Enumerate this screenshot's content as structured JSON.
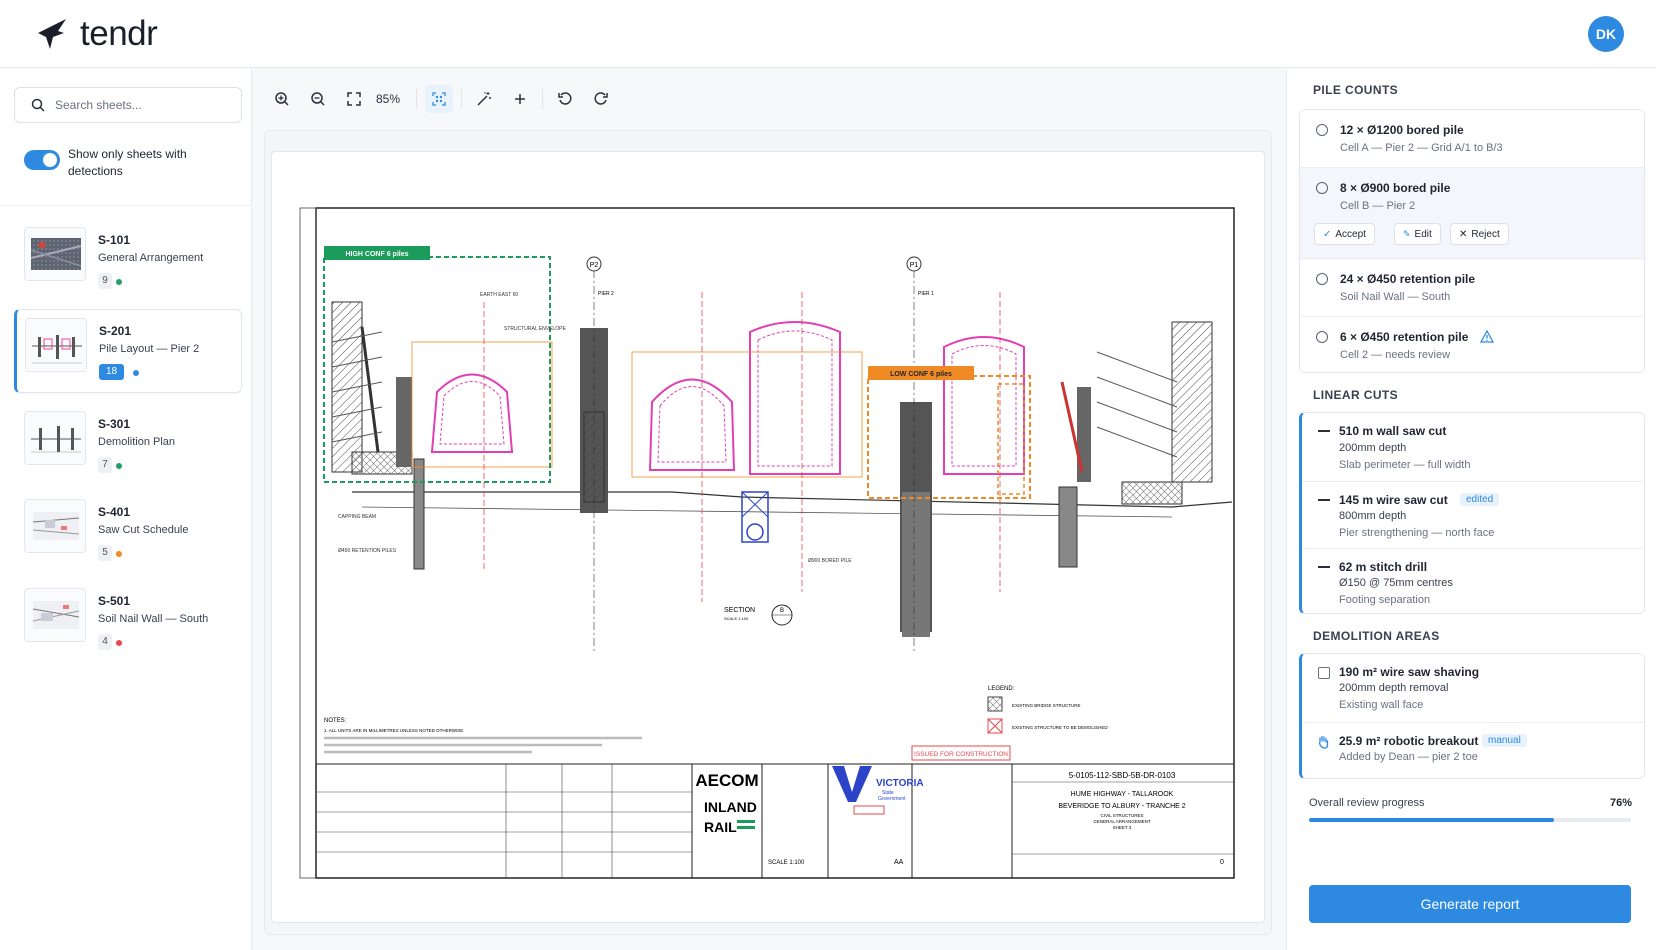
{
  "app": {
    "brand": "tendr",
    "user_initials": "DK"
  },
  "sidebar": {
    "search_placeholder": "Search sheets...",
    "filter_toggle_label": "Show only sheets with detections",
    "filter_toggle_on": true,
    "sheets": [
      {
        "code": "S-101",
        "name": "General Arrangement",
        "count": "9",
        "status_color": "#22a06b"
      },
      {
        "code": "S-201",
        "name": "Pile Layout — Pier 2",
        "count": "18",
        "status_color": "#2d8ae0",
        "active": true
      },
      {
        "code": "S-301",
        "name": "Demolition Plan",
        "count": "7",
        "status_color": "#22a06b"
      },
      {
        "code": "S-401",
        "name": "Saw Cut Schedule",
        "count": "5",
        "status_color": "#f08a24"
      },
      {
        "code": "S-501",
        "name": "Soil Nail Wall — South",
        "count": "4",
        "status_color": "#e5484d"
      }
    ]
  },
  "toolbar": {
    "zoom": "85%"
  },
  "drawing": {
    "high_conf_label": "HIGH CONF 6 piles",
    "low_conf_label": "LOW CONF 6 piles",
    "issued_stamp": "ISSUED FOR CONSTRUCTION",
    "drawing_number": "5-0105-112-SBD-5B-DR-0103",
    "project_title_1": "HUME HIGHWAY - TALLAROOK",
    "project_title_2": "BEVERIDGE TO ALBURY - TRANCHE 2",
    "project_title_3": "CIVIL STRUCTURES",
    "project_title_4": "GENERAL ARRANGEMENT",
    "project_title_5": "SHEET 3",
    "aecom": "AECOM",
    "inland_rail_1": "INLAND",
    "inland_rail_2": "RAIL",
    "victoria": "VICTORIA",
    "victoria_sub_1": "State",
    "victoria_sub_2": "Government",
    "section_label": "SECTION",
    "section_scale": "SCALE 1:100",
    "section_ref": "B",
    "legend_title": "LEGEND:",
    "legend_1": "EXISTING BRIDGE STRUCTURE",
    "legend_2": "EXISTING STRUCTURE TO BE DEMOLISHED",
    "notes_title": "NOTES:",
    "notes_1": "1.  ALL UNITS ARE IN MILLIMETRES UNLESS NOTED OTHERWISE.",
    "label_p2": "P2",
    "label_p1": "P1",
    "label_pier2": "PIER 2",
    "label_pier1": "PIER 1",
    "label_capping_beam": "CAPPING BEAM",
    "label_retention_piles": "Ø450 RETENTION PILES",
    "label_bored_piles": "Ø900 BORED PILE",
    "label_structural_envelope": "STRUCTURAL ENVELOPE",
    "label_earth_east": "EARTH EAST 60",
    "scale_text": "SCALE 1:100",
    "revision": "0",
    "rev_aa": "AA"
  },
  "right_panel": {
    "pile_counts": {
      "title": "PILE COUNTS",
      "items": [
        {
          "title": "12 × Ø1200 bored pile",
          "sub": "Cell A — Pier 2 — Grid A/1 to B/3"
        },
        {
          "title": "8 × Ø900 bored pile",
          "sub": "Cell B — Pier 2",
          "actions": [
            "Accept",
            "Edit",
            "Reject"
          ]
        },
        {
          "title": "24 × Ø450 retention pile",
          "sub": "Soil Nail Wall — South"
        },
        {
          "title": "6 × Ø450 retention pile",
          "sub": "Cell 2 — needs review",
          "warning": true
        }
      ]
    },
    "linear_cuts": {
      "title": "LINEAR CUTS",
      "items": [
        {
          "title": "510 m wall saw cut",
          "line2": "200mm depth",
          "sub": "Slab perimeter — full width"
        },
        {
          "title": "145 m wire saw cut",
          "tag": "edited",
          "line2": "800mm depth",
          "sub": "Pier strengthening — north face"
        },
        {
          "title": "62 m stitch drill",
          "line2": "Ø150 @ 75mm centres",
          "sub": "Footing separation"
        }
      ]
    },
    "demolition_areas": {
      "title": "DEMOLITION AREAS",
      "items": [
        {
          "title": "190 m² wire saw shaving",
          "line2": "200mm depth removal",
          "sub": "Existing wall face"
        },
        {
          "title": "25.9 m² robotic breakout",
          "tag": "manual",
          "sub": "Added by Dean — pier 2 toe"
        }
      ]
    },
    "progress": {
      "label": "Overall review progress",
      "value_text": "76%",
      "value": 0.76
    },
    "generate_label": "Generate report"
  }
}
